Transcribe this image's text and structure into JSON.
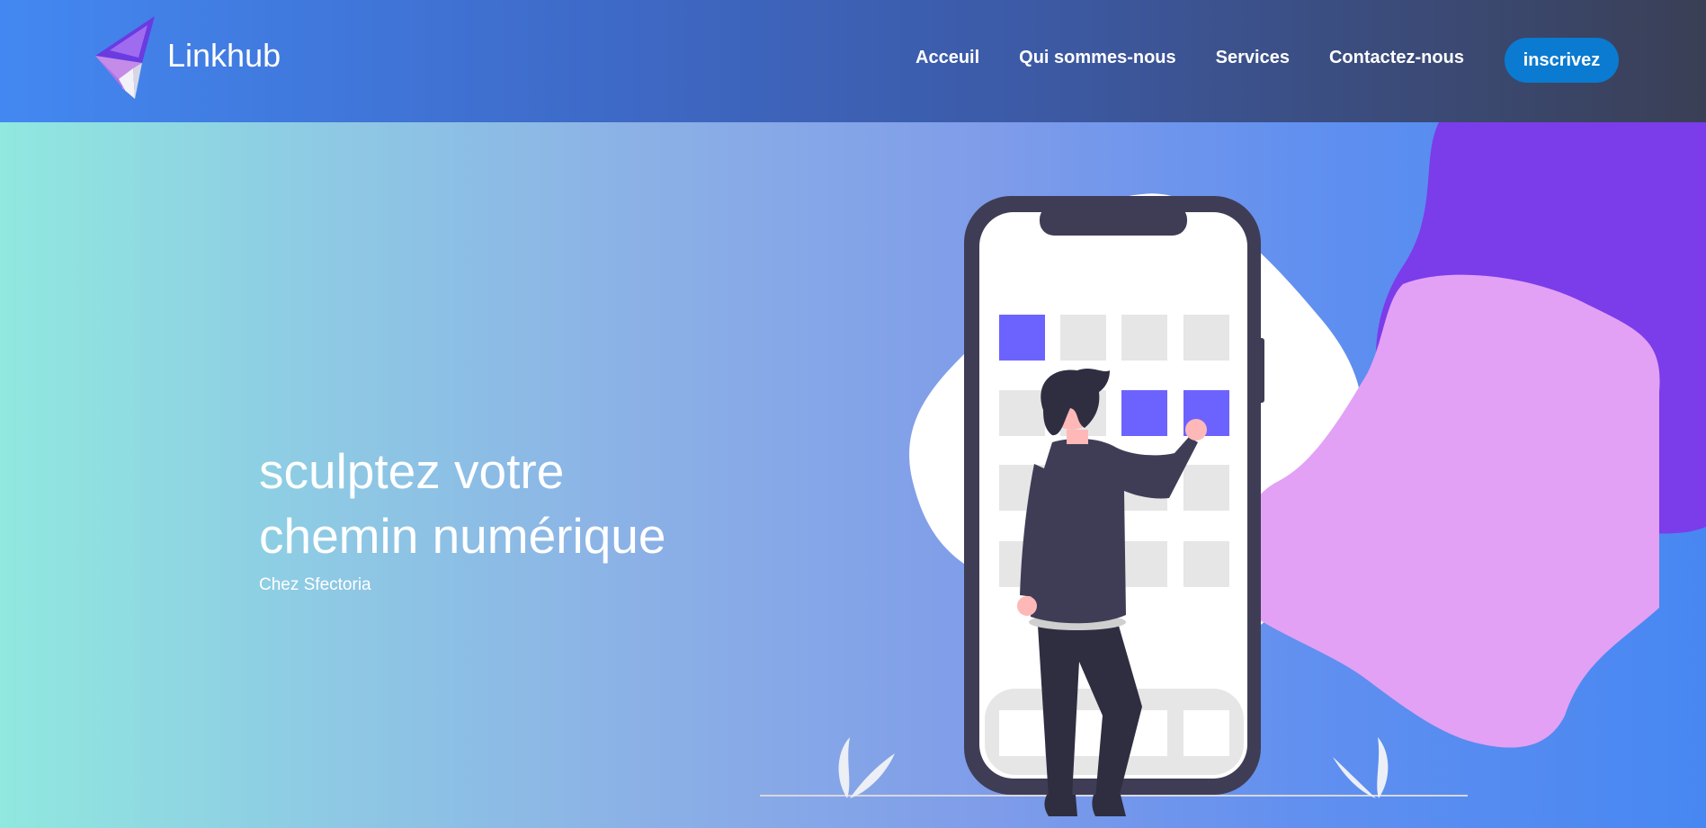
{
  "brand": {
    "name": "Linkhub",
    "logo_icon": "paper-plane-logo-icon"
  },
  "nav": {
    "items": [
      {
        "label": "Acceuil"
      },
      {
        "label": "Qui sommes-nous"
      },
      {
        "label": "Services"
      },
      {
        "label": "Contactez-nous"
      }
    ],
    "cta_label": "inscrivez"
  },
  "hero": {
    "title_line1": "sculptez votre",
    "title_line2": "chemin numérique",
    "subtitle": "Chez Sfectoria"
  },
  "colors": {
    "header_start": "#4388f2",
    "header_end": "#3a3f55",
    "cta": "#0a7bd0",
    "hero_start": "#90e8df",
    "hero_end": "#4787f2",
    "tile_active": "#6c63ff",
    "blob_purple": "#7b3cea",
    "blob_pink": "#e2a1f5"
  }
}
